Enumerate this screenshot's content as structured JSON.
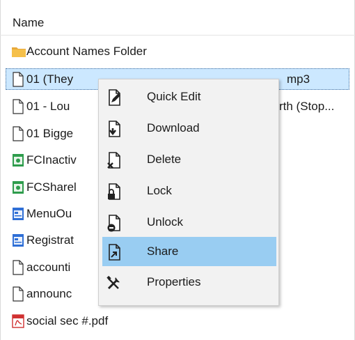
{
  "list": {
    "header": "Name",
    "rows": [
      {
        "name": "Account Names Folder",
        "icon": "folder-icon"
      },
      {
        "name": "01 (They Call It) Stormy Monday.mp3",
        "visible_left": "01 (They",
        "visible_right": "mp3",
        "icon": "file-icon",
        "selected": true
      },
      {
        "name": "01 - Lou ... rth (Stop...",
        "visible_left": "01 - Lou",
        "visible_right": "rth (Stop...",
        "icon": "file-icon"
      },
      {
        "name": "01 Bigge",
        "icon": "file-icon"
      },
      {
        "name": "FCInactiv",
        "icon": "image-file-icon"
      },
      {
        "name": "FCSharel",
        "icon": "image-file-icon"
      },
      {
        "name": "MenuOu",
        "icon": "document-file-icon"
      },
      {
        "name": "Registrat",
        "icon": "document-file-icon"
      },
      {
        "name": "accounti",
        "icon": "file-icon"
      },
      {
        "name": "announc",
        "icon": "file-icon"
      },
      {
        "name": "social sec #.pdf",
        "icon": "pdf-file-icon"
      }
    ]
  },
  "context_menu": {
    "items": [
      {
        "label": "Quick Edit",
        "icon": "quick-edit-icon"
      },
      {
        "label": "Download",
        "icon": "download-icon"
      },
      {
        "label": "Delete",
        "icon": "delete-icon"
      },
      {
        "label": "Lock",
        "icon": "lock-icon"
      },
      {
        "label": "Unlock",
        "icon": "unlock-icon"
      },
      {
        "label": "Share",
        "icon": "share-icon",
        "highlighted": true
      },
      {
        "label": "Properties",
        "icon": "properties-icon"
      }
    ]
  },
  "colors": {
    "selection": "#cce8ff",
    "menu_highlight": "#99cdf2",
    "menu_background": "#f2f2f2",
    "folder": "#e8a93b",
    "image_icon": "#2e9c4c",
    "doc_icon": "#2f6fd6",
    "pdf_icon": "#d03030"
  }
}
